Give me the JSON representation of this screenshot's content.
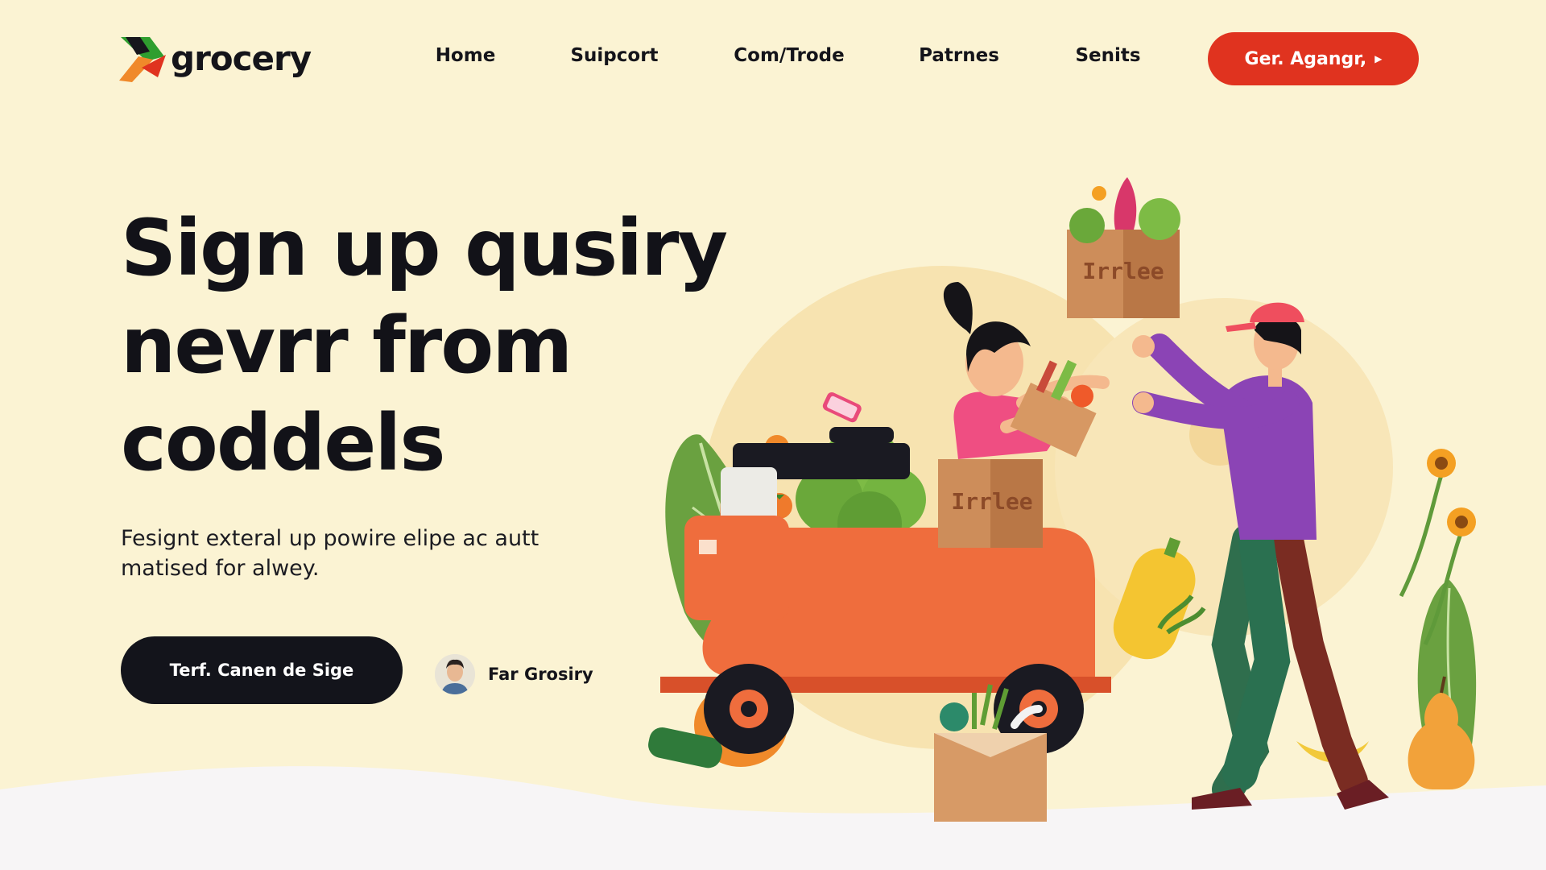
{
  "brand": {
    "name": "grocery",
    "colors": {
      "background": "#fbf3d3",
      "accent": "#e0331f",
      "dark": "#13141b",
      "logo_green": "#2f9e2f",
      "logo_orange": "#f0892a"
    }
  },
  "nav": {
    "links": [
      "Home",
      "Suipcort",
      "Com/Trode",
      "Patrnes",
      "Senits"
    ],
    "cta": {
      "label": "Ger. Agangr,",
      "icon": "arrow-right-icon"
    }
  },
  "hero": {
    "title_lines": [
      "Sign up qusiry",
      "nevrr from",
      "coddels"
    ],
    "subtitle_lines": [
      "Fesignt exteral up powire elipe ac autt",
      "matised for alwey."
    ],
    "cta_label": "Terf. Canen de Sige",
    "user": {
      "name": "Far Grosiry",
      "icon": "avatar-icon"
    }
  },
  "illustration": {
    "box_labels": [
      "Irrlee",
      "Irrlee"
    ]
  }
}
